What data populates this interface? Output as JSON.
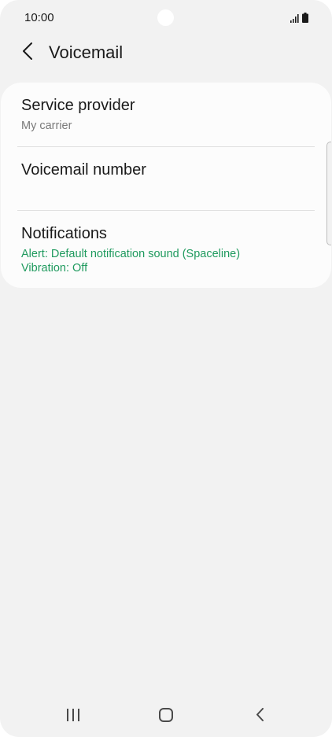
{
  "status_bar": {
    "time": "10:00",
    "signal_icon": "signal-icon",
    "battery_icon": "battery-icon"
  },
  "header": {
    "back_icon": "chevron-left-icon",
    "title": "Voicemail"
  },
  "settings": {
    "items": [
      {
        "title": "Service provider",
        "subtitle": "My carrier"
      },
      {
        "title": "Voicemail number"
      },
      {
        "title": "Notifications",
        "subtitle_lines": [
          "Alert: Default notification sound (Spaceline)",
          "Vibration: Off"
        ]
      }
    ]
  },
  "nav_bar": {
    "recents_icon": "recents-icon",
    "home_icon": "home-icon",
    "back_icon": "back-icon"
  },
  "colors": {
    "background": "#f2f2f2",
    "card": "#fcfcfc",
    "accent": "#1f9a5e",
    "text": "#1a1a1a",
    "secondary_text": "#7a7a7a"
  }
}
